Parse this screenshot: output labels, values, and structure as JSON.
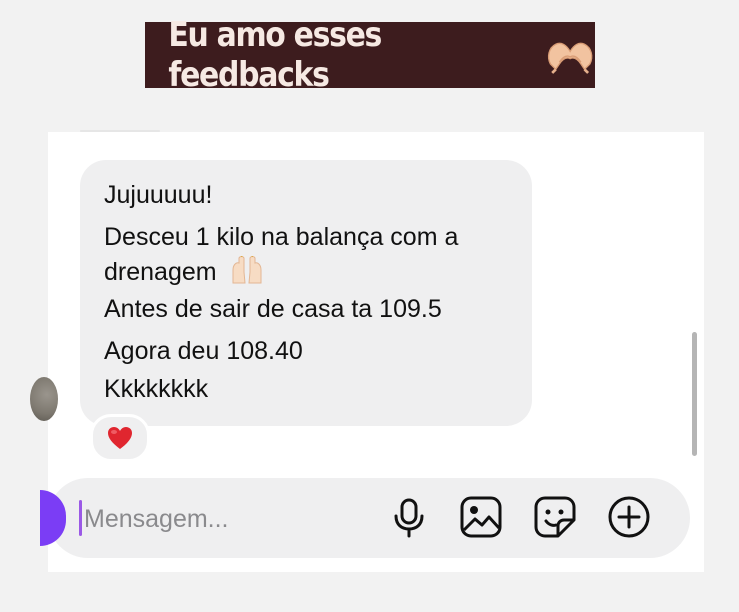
{
  "banner": {
    "title": "Eu amo esses feedbacks"
  },
  "message": {
    "lines": [
      "Jujuuuuu!",
      "Desceu 1 kilo na balança com a",
      "drenagem",
      "Antes de sair de casa ta 109.5",
      "Agora deu 108.40",
      "Kkkkkkkk"
    ],
    "reaction": "❤️"
  },
  "composer": {
    "placeholder": "Mensagem...",
    "icons": [
      "microphone-icon",
      "image-icon",
      "sticker-icon",
      "plus-circle-icon"
    ]
  },
  "colors": {
    "banner_bg": "#3d1c1e",
    "banner_text": "#f6e9e3",
    "accent": "#7b3df5",
    "bubble_bg": "#efeff0"
  }
}
